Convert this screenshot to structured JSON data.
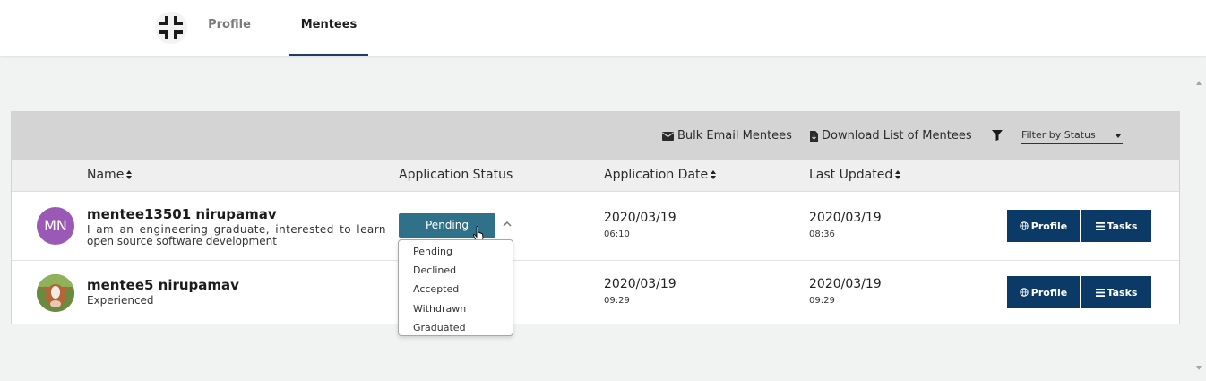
{
  "header": {
    "tabs": [
      {
        "label": "Profile",
        "active": false
      },
      {
        "label": "Mentees",
        "active": true
      }
    ]
  },
  "toolbar": {
    "bulk_email_label": "Bulk Email Mentees",
    "download_label": "Download List of Mentees",
    "filter_placeholder": "Filter by Status"
  },
  "table": {
    "columns": [
      "Name",
      "Application Status",
      "Application Date",
      "Last Updated"
    ],
    "rows": [
      {
        "avatar_initials": "MN",
        "name": "mentee13501 nirupamav",
        "bio_line1": "I am an engineering graduate, interested to learn",
        "bio_line2": "open source software development",
        "status": "Pending",
        "application_date": "2020/03/19",
        "application_time": "06:10",
        "last_updated_date": "2020/03/19",
        "last_updated_time": "08:36",
        "profile_label": "Profile",
        "tasks_label": "Tasks"
      },
      {
        "avatar_initials": "",
        "name": "mentee5 nirupamav",
        "bio_line1": "Experienced",
        "bio_line2": "",
        "status": "",
        "application_date": "2020/03/19",
        "application_time": "09:29",
        "last_updated_date": "2020/03/19",
        "last_updated_time": "09:29",
        "profile_label": "Profile",
        "tasks_label": "Tasks"
      }
    ]
  },
  "status_dropdown": {
    "options": [
      "Pending",
      "Declined",
      "Accepted",
      "Withdrawn",
      "Graduated"
    ]
  },
  "colors": {
    "primary_button": "#0c3a66",
    "status_button": "#2f7188",
    "avatar_mn": "#9b59b6",
    "active_tab_underline": "#1f3e66"
  },
  "icons": {
    "logo": "crosshair-logo-icon",
    "email": "envelope-icon",
    "download": "file-download-icon",
    "filter": "funnel-icon",
    "sort": "sort-icon",
    "globe": "globe-icon",
    "list": "list-icon",
    "chevron": "chevron-up-icon",
    "cursor": "hand-pointer-icon"
  }
}
